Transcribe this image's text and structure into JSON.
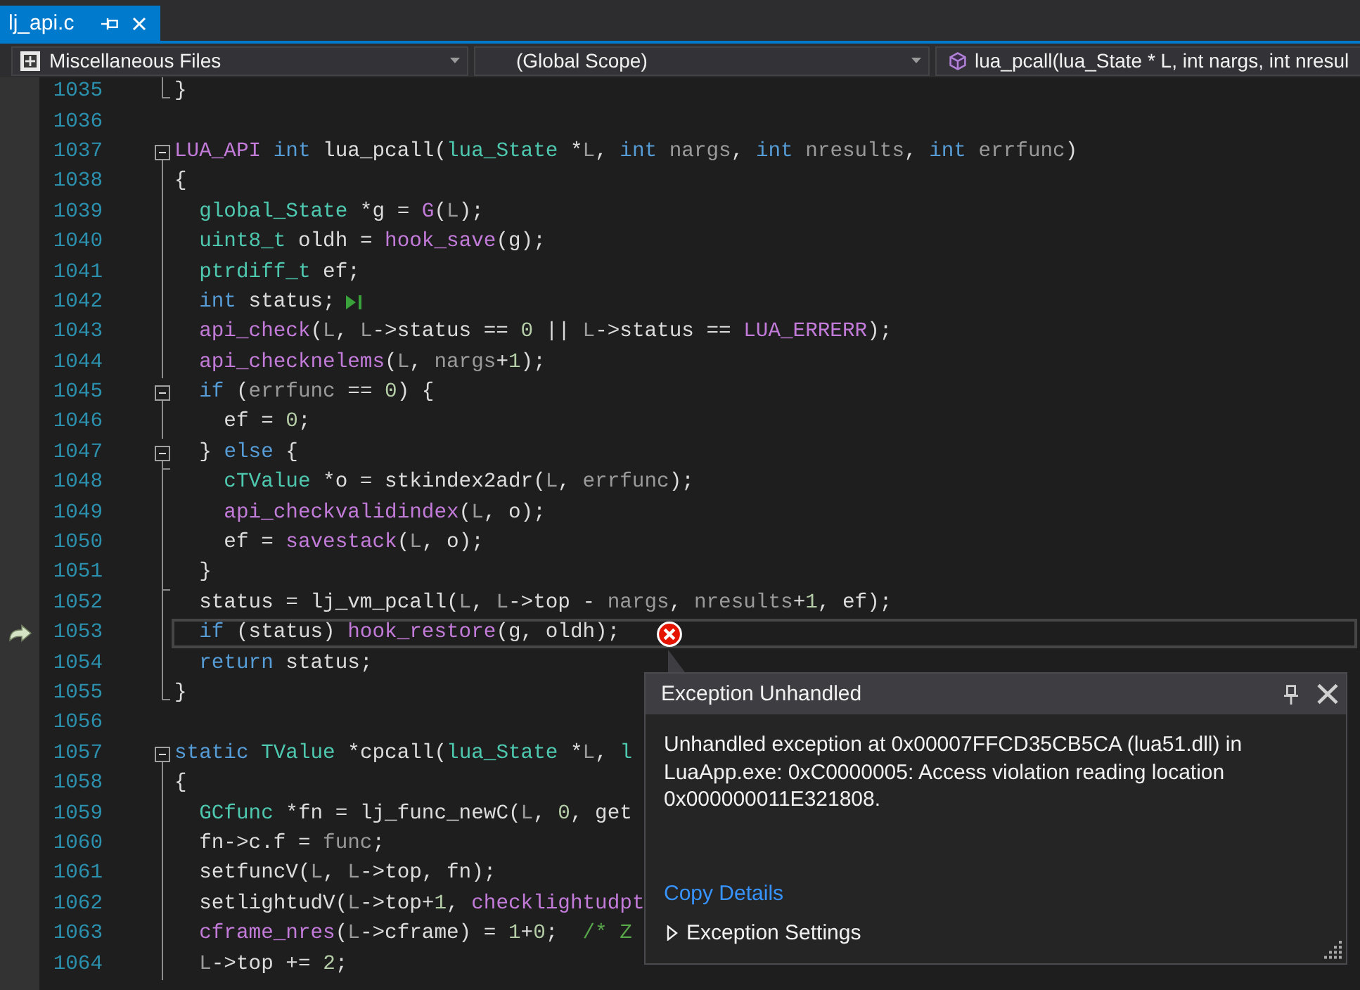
{
  "tabs": [
    {
      "label": "lj_api.c",
      "selected": true
    }
  ],
  "navigation_bar": {
    "dropdowns": [
      {
        "kind": "project",
        "text": "Miscellaneous Files"
      },
      {
        "kind": "scope",
        "text": "(Global Scope)"
      },
      {
        "kind": "member",
        "text": "lua_pcall(lua_State * L, int nargs, int nresul"
      }
    ]
  },
  "editor": {
    "lines": [
      {
        "number": "1035",
        "current": false,
        "run_to_cursor": false,
        "outline": {
          "kind": "end"
        },
        "tokens": [
          {
            "kind": "plain",
            "text": "}"
          }
        ]
      },
      {
        "number": "1036",
        "current": false,
        "run_to_cursor": false
      },
      {
        "number": "1037",
        "current": false,
        "run_to_cursor": false,
        "outline": {
          "kind": "toggle",
          "expanded": true
        },
        "tokens": [
          {
            "kind": "macro",
            "text": "LUA_API"
          },
          {
            "kind": "keyword",
            "text": " int"
          },
          {
            "kind": "plain",
            "text": " lua_pcall("
          },
          {
            "kind": "type",
            "text": "lua_State"
          },
          {
            "kind": "plain",
            "text": " *"
          },
          {
            "kind": "param",
            "text": "L"
          },
          {
            "kind": "plain",
            "text": ", "
          },
          {
            "kind": "keyword",
            "text": "int"
          },
          {
            "kind": "param",
            "text": " nargs"
          },
          {
            "kind": "plain",
            "text": ", "
          },
          {
            "kind": "keyword",
            "text": "int"
          },
          {
            "kind": "param",
            "text": " nresults"
          },
          {
            "kind": "plain",
            "text": ", "
          },
          {
            "kind": "keyword",
            "text": "int"
          },
          {
            "kind": "param",
            "text": " errfunc"
          },
          {
            "kind": "plain",
            "text": ")"
          }
        ]
      },
      {
        "number": "1038",
        "current": false,
        "run_to_cursor": false,
        "outline": {
          "kind": "line"
        },
        "tokens": [
          {
            "kind": "plain",
            "text": "{"
          }
        ]
      },
      {
        "number": "1039",
        "current": false,
        "run_to_cursor": false,
        "outline": {
          "kind": "line"
        },
        "tokens": [
          {
            "kind": "type",
            "text": "  global_State"
          },
          {
            "kind": "plain",
            "text": " *g = "
          },
          {
            "kind": "macro",
            "text": "G"
          },
          {
            "kind": "plain",
            "text": "("
          },
          {
            "kind": "param",
            "text": "L"
          },
          {
            "kind": "plain",
            "text": ");"
          }
        ]
      },
      {
        "number": "1040",
        "current": false,
        "run_to_cursor": false,
        "outline": {
          "kind": "line"
        },
        "tokens": [
          {
            "kind": "type",
            "text": "  uint8_t"
          },
          {
            "kind": "plain",
            "text": " oldh = "
          },
          {
            "kind": "macro",
            "text": "hook_save"
          },
          {
            "kind": "plain",
            "text": "(g);"
          }
        ]
      },
      {
        "number": "1041",
        "current": false,
        "run_to_cursor": false,
        "outline": {
          "kind": "line"
        },
        "tokens": [
          {
            "kind": "type",
            "text": "  ptrdiff_t"
          },
          {
            "kind": "plain",
            "text": " ef;"
          }
        ]
      },
      {
        "number": "1042",
        "current": false,
        "run_to_cursor": true,
        "outline": {
          "kind": "line"
        },
        "tokens": [
          {
            "kind": "keyword",
            "text": "  int"
          },
          {
            "kind": "plain",
            "text": " status;"
          }
        ]
      },
      {
        "number": "1043",
        "current": false,
        "run_to_cursor": false,
        "outline": {
          "kind": "line"
        },
        "tokens": [
          {
            "kind": "macro",
            "text": "  api_check"
          },
          {
            "kind": "plain",
            "text": "("
          },
          {
            "kind": "param",
            "text": "L"
          },
          {
            "kind": "plain",
            "text": ", "
          },
          {
            "kind": "param",
            "text": "L"
          },
          {
            "kind": "plain",
            "text": "->status == "
          },
          {
            "kind": "number",
            "text": "0"
          },
          {
            "kind": "plain",
            "text": " || "
          },
          {
            "kind": "param",
            "text": "L"
          },
          {
            "kind": "plain",
            "text": "->status == "
          },
          {
            "kind": "macro",
            "text": "LUA_ERRERR"
          },
          {
            "kind": "plain",
            "text": ");"
          }
        ]
      },
      {
        "number": "1044",
        "current": false,
        "run_to_cursor": false,
        "outline": {
          "kind": "line"
        },
        "tokens": [
          {
            "kind": "macro",
            "text": "  api_checknelems"
          },
          {
            "kind": "plain",
            "text": "("
          },
          {
            "kind": "param",
            "text": "L"
          },
          {
            "kind": "plain",
            "text": ", "
          },
          {
            "kind": "param",
            "text": "nargs"
          },
          {
            "kind": "plain",
            "text": "+"
          },
          {
            "kind": "number",
            "text": "1"
          },
          {
            "kind": "plain",
            "text": ");"
          }
        ]
      },
      {
        "number": "1045",
        "current": false,
        "run_to_cursor": false,
        "outline": {
          "kind": "toggle",
          "expanded": true
        },
        "tokens": [
          {
            "kind": "keyword",
            "text": "  if"
          },
          {
            "kind": "plain",
            "text": " ("
          },
          {
            "kind": "param",
            "text": "errfunc"
          },
          {
            "kind": "plain",
            "text": " == "
          },
          {
            "kind": "number",
            "text": "0"
          },
          {
            "kind": "plain",
            "text": ") {"
          }
        ]
      },
      {
        "number": "1046",
        "current": false,
        "run_to_cursor": false,
        "outline": {
          "kind": "line"
        },
        "tokens": [
          {
            "kind": "plain",
            "text": "    ef = "
          },
          {
            "kind": "number",
            "text": "0"
          },
          {
            "kind": "plain",
            "text": ";"
          }
        ]
      },
      {
        "number": "1047",
        "current": false,
        "run_to_cursor": false,
        "outline": {
          "kind": "toggle",
          "expanded": true
        },
        "tokens": [
          {
            "kind": "plain",
            "text": "  } "
          },
          {
            "kind": "keyword",
            "text": "else"
          },
          {
            "kind": "plain",
            "text": " {"
          }
        ]
      },
      {
        "number": "1048",
        "current": false,
        "run_to_cursor": false,
        "outline": {
          "kind": "tick"
        },
        "tokens": [
          {
            "kind": "type",
            "text": "    cTValue"
          },
          {
            "kind": "plain",
            "text": " *o = stkindex2adr("
          },
          {
            "kind": "param",
            "text": "L"
          },
          {
            "kind": "plain",
            "text": ", "
          },
          {
            "kind": "param",
            "text": "errfunc"
          },
          {
            "kind": "plain",
            "text": ");"
          }
        ]
      },
      {
        "number": "1049",
        "current": false,
        "run_to_cursor": false,
        "outline": {
          "kind": "line"
        },
        "tokens": [
          {
            "kind": "macro",
            "text": "    api_checkvalidindex"
          },
          {
            "kind": "plain",
            "text": "("
          },
          {
            "kind": "param",
            "text": "L"
          },
          {
            "kind": "plain",
            "text": ", o);"
          }
        ]
      },
      {
        "number": "1050",
        "current": false,
        "run_to_cursor": false,
        "outline": {
          "kind": "line"
        },
        "tokens": [
          {
            "kind": "plain",
            "text": "    ef = "
          },
          {
            "kind": "macro",
            "text": "savestack"
          },
          {
            "kind": "plain",
            "text": "("
          },
          {
            "kind": "param",
            "text": "L"
          },
          {
            "kind": "plain",
            "text": ", o);"
          }
        ]
      },
      {
        "number": "1051",
        "current": false,
        "run_to_cursor": false,
        "outline": {
          "kind": "line"
        },
        "tokens": [
          {
            "kind": "plain",
            "text": "  }"
          }
        ]
      },
      {
        "number": "1052",
        "current": false,
        "run_to_cursor": false,
        "outline": {
          "kind": "tick"
        },
        "tokens": [
          {
            "kind": "plain",
            "text": "  status = lj_vm_pcall("
          },
          {
            "kind": "param",
            "text": "L"
          },
          {
            "kind": "plain",
            "text": ", "
          },
          {
            "kind": "param",
            "text": "L"
          },
          {
            "kind": "plain",
            "text": "->top - "
          },
          {
            "kind": "param",
            "text": "nargs"
          },
          {
            "kind": "plain",
            "text": ", "
          },
          {
            "kind": "param",
            "text": "nresults"
          },
          {
            "kind": "plain",
            "text": "+"
          },
          {
            "kind": "number",
            "text": "1"
          },
          {
            "kind": "plain",
            "text": ", ef);"
          }
        ]
      },
      {
        "number": "1053",
        "current": true,
        "run_to_cursor": false,
        "outline": {
          "kind": "line"
        },
        "tokens": [
          {
            "kind": "keyword",
            "text": "  if"
          },
          {
            "kind": "plain",
            "text": " (status) "
          },
          {
            "kind": "macro",
            "text": "hook_restore"
          },
          {
            "kind": "plain",
            "text": "(g, oldh);"
          }
        ]
      },
      {
        "number": "1054",
        "current": false,
        "run_to_cursor": false,
        "outline": {
          "kind": "line"
        },
        "tokens": [
          {
            "kind": "keyword",
            "text": "  return"
          },
          {
            "kind": "plain",
            "text": " status;"
          }
        ]
      },
      {
        "number": "1055",
        "current": false,
        "run_to_cursor": false,
        "outline": {
          "kind": "end"
        },
        "tokens": [
          {
            "kind": "plain",
            "text": "}"
          }
        ]
      },
      {
        "number": "1056",
        "current": false,
        "run_to_cursor": false
      },
      {
        "number": "1057",
        "current": false,
        "run_to_cursor": false,
        "outline": {
          "kind": "toggle",
          "expanded": true
        },
        "tokens": [
          {
            "kind": "keyword",
            "text": "static"
          },
          {
            "kind": "type",
            "text": " TValue"
          },
          {
            "kind": "plain",
            "text": " *cpcall("
          },
          {
            "kind": "type",
            "text": "lua_State"
          },
          {
            "kind": "plain",
            "text": " *"
          },
          {
            "kind": "param",
            "text": "L"
          },
          {
            "kind": "plain",
            "text": ", "
          },
          {
            "kind": "type",
            "text": "l"
          }
        ]
      },
      {
        "number": "1058",
        "current": false,
        "run_to_cursor": false,
        "outline": {
          "kind": "line"
        },
        "tokens": [
          {
            "kind": "plain",
            "text": "{"
          }
        ]
      },
      {
        "number": "1059",
        "current": false,
        "run_to_cursor": false,
        "outline": {
          "kind": "line"
        },
        "tokens": [
          {
            "kind": "type",
            "text": "  GCfunc"
          },
          {
            "kind": "plain",
            "text": " *fn = lj_func_newC("
          },
          {
            "kind": "param",
            "text": "L"
          },
          {
            "kind": "plain",
            "text": ", "
          },
          {
            "kind": "number",
            "text": "0"
          },
          {
            "kind": "plain",
            "text": ", get"
          }
        ]
      },
      {
        "number": "1060",
        "current": false,
        "run_to_cursor": false,
        "outline": {
          "kind": "line"
        },
        "tokens": [
          {
            "kind": "plain",
            "text": "  fn->c.f = "
          },
          {
            "kind": "param",
            "text": "func"
          },
          {
            "kind": "plain",
            "text": ";"
          }
        ]
      },
      {
        "number": "1061",
        "current": false,
        "run_to_cursor": false,
        "outline": {
          "kind": "line"
        },
        "tokens": [
          {
            "kind": "plain",
            "text": "  setfuncV("
          },
          {
            "kind": "param",
            "text": "L"
          },
          {
            "kind": "plain",
            "text": ", "
          },
          {
            "kind": "param",
            "text": "L"
          },
          {
            "kind": "plain",
            "text": "->top, fn);"
          }
        ]
      },
      {
        "number": "1062",
        "current": false,
        "run_to_cursor": false,
        "outline": {
          "kind": "line"
        },
        "tokens": [
          {
            "kind": "plain",
            "text": "  setlightudV("
          },
          {
            "kind": "param",
            "text": "L"
          },
          {
            "kind": "plain",
            "text": "->top+"
          },
          {
            "kind": "number",
            "text": "1"
          },
          {
            "kind": "plain",
            "text": ", "
          },
          {
            "kind": "macro",
            "text": "checklightudpt"
          }
        ]
      },
      {
        "number": "1063",
        "current": false,
        "run_to_cursor": false,
        "outline": {
          "kind": "line"
        },
        "tokens": [
          {
            "kind": "macro",
            "text": "  cframe_nres"
          },
          {
            "kind": "plain",
            "text": "("
          },
          {
            "kind": "param",
            "text": "L"
          },
          {
            "kind": "plain",
            "text": "->cframe) = "
          },
          {
            "kind": "number",
            "text": "1"
          },
          {
            "kind": "plain",
            "text": "+"
          },
          {
            "kind": "number",
            "text": "0"
          },
          {
            "kind": "plain",
            "text": ";  "
          },
          {
            "kind": "comment",
            "text": "/* Z"
          }
        ]
      },
      {
        "number": "1064",
        "current": false,
        "run_to_cursor": false,
        "outline": {
          "kind": "line"
        },
        "tokens": [
          {
            "kind": "param",
            "text": "  L"
          },
          {
            "kind": "plain",
            "text": "->top += "
          },
          {
            "kind": "number",
            "text": "2"
          },
          {
            "kind": "plain",
            "text": ";"
          }
        ]
      }
    ]
  },
  "exception_popup": {
    "title": "Exception Unhandled",
    "message": "Unhandled exception at 0x00007FFCD35CB5CA (lua51.dll) in LuaApp.exe: 0xC0000005: Access violation reading location 0x000000011E321808.",
    "link": "Copy Details",
    "settings": {
      "label": "Exception Settings",
      "expanded": false
    }
  }
}
